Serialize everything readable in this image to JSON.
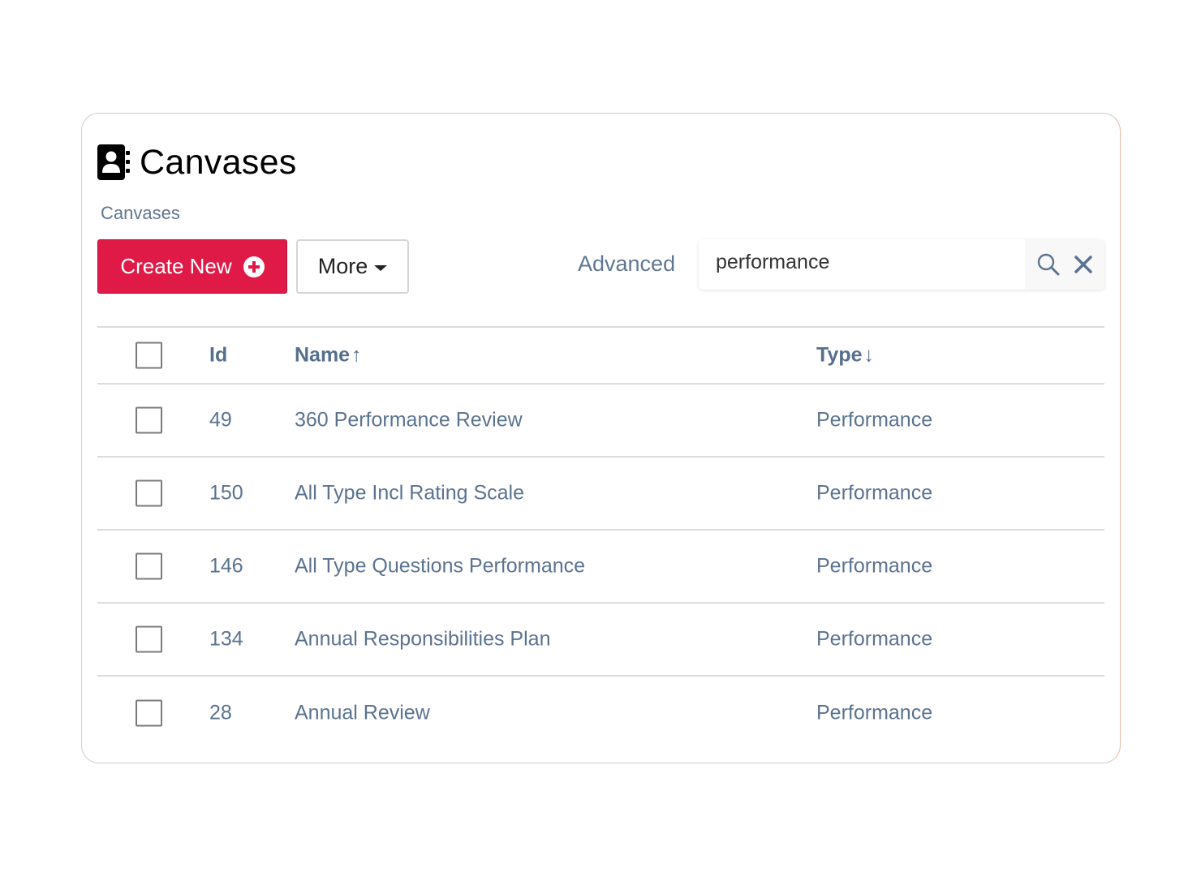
{
  "page": {
    "title": "Canvases",
    "breadcrumb": "Canvases",
    "title_icon": "address-book-icon"
  },
  "toolbar": {
    "create_label": "Create New",
    "create_icon": "plus-circle-icon",
    "more_label": "More",
    "advanced_label": "Advanced"
  },
  "search": {
    "value": "performance",
    "placeholder": "",
    "search_icon": "search-icon",
    "clear_icon": "close-icon"
  },
  "colors": {
    "primary": "#e01a47",
    "text_muted": "#5a7390"
  },
  "table": {
    "columns": [
      {
        "key": "select",
        "label": ""
      },
      {
        "key": "id",
        "label": "Id"
      },
      {
        "key": "name",
        "label": "Name",
        "sort": "↑"
      },
      {
        "key": "type",
        "label": "Type",
        "sort": "↓"
      }
    ],
    "rows": [
      {
        "id": "49",
        "name": "360 Performance Review",
        "type": "Performance",
        "checked": false
      },
      {
        "id": "150",
        "name": "All Type Incl Rating Scale",
        "type": "Performance",
        "checked": false
      },
      {
        "id": "146",
        "name": "All Type Questions Performance",
        "type": "Performance",
        "checked": false
      },
      {
        "id": "134",
        "name": "Annual Responsibilities Plan",
        "type": "Performance",
        "checked": false
      },
      {
        "id": "28",
        "name": "Annual Review",
        "type": "Performance",
        "checked": false
      }
    ]
  }
}
